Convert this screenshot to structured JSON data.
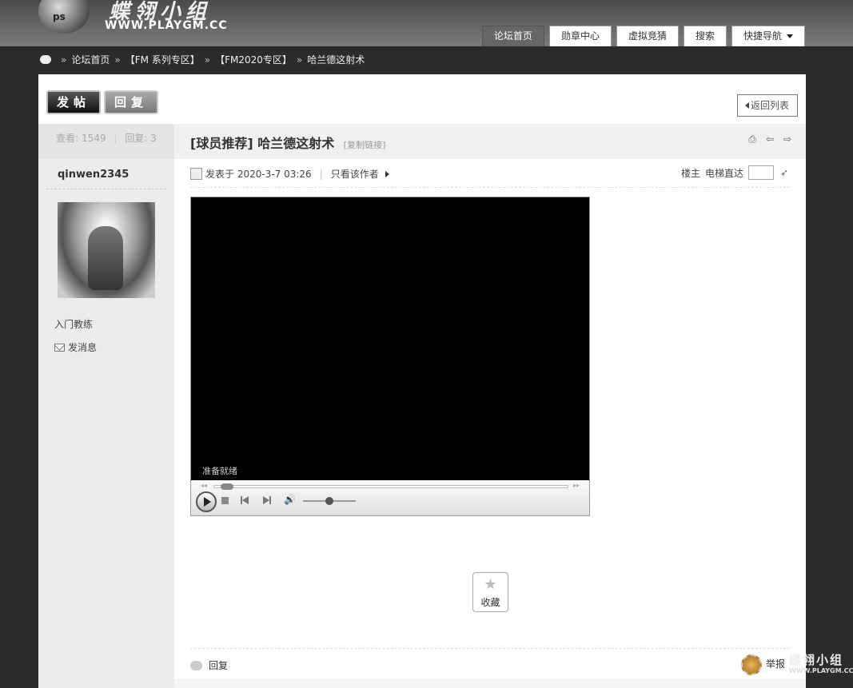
{
  "header": {
    "logo_badge": "ps",
    "logo_cn": "蝶翎小组",
    "logo_url": "WWW.PLAYGM.CC",
    "nav": [
      {
        "label": "论坛首页",
        "active": true
      },
      {
        "label": "勋章中心"
      },
      {
        "label": "虚拟竞猜"
      },
      {
        "label": "搜索"
      },
      {
        "label": "快捷导航"
      }
    ]
  },
  "breadcrumb": {
    "sep": "»",
    "items": [
      "论坛首页",
      "【FM 系列专区】",
      "【FM2020专区】",
      "哈兰德这射术"
    ]
  },
  "toolbar": {
    "post_label": "发帖",
    "reply_label": "回复",
    "back_label": "返回列表"
  },
  "stats": {
    "views_label": "查看:",
    "views": "1549",
    "replies_label": "回复:",
    "replies": "3"
  },
  "author": {
    "name": "qinwen2345",
    "title": "入门教练",
    "send_message": "发消息"
  },
  "thread": {
    "title": "[球员推荐] 哈兰德这射术",
    "copy_link": "[复制链接]"
  },
  "post": {
    "posted_at": "发表于 2020-3-7 03:26",
    "only_author": "只看该作者",
    "floor": "楼主",
    "jump_label": "电梯直达"
  },
  "player": {
    "status": "准备就绪",
    "progress": 0.02,
    "volume": 0.5
  },
  "favorite": {
    "label": "收藏"
  },
  "footer": {
    "reply": "回复",
    "report": "举报"
  },
  "watermark": {
    "cn": "蝶翎小组",
    "url": "WWW.PLAYGM.CC"
  }
}
